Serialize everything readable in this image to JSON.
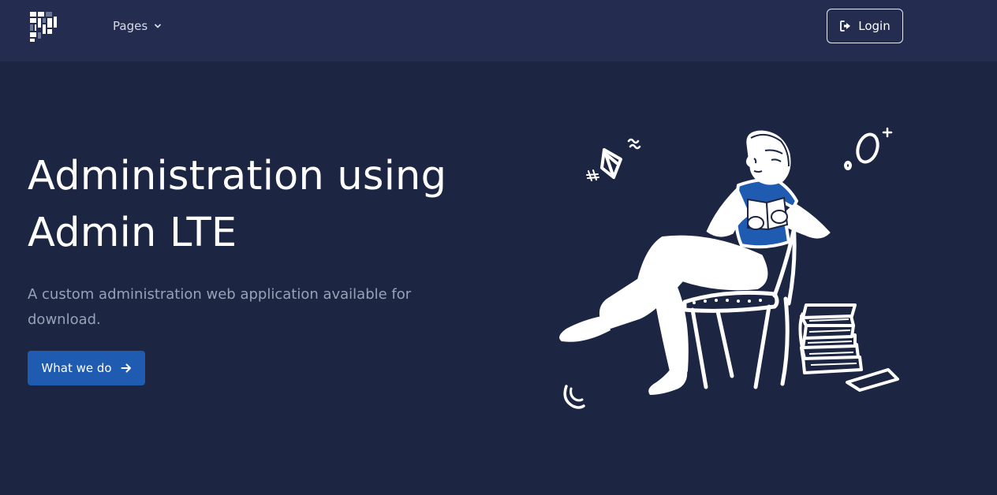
{
  "navbar": {
    "pages_label": "Pages",
    "login_label": "Login"
  },
  "hero": {
    "title_line1": "Administration using",
    "title_line2": "Admin LTE",
    "subtitle": "A custom administration web application available for download.",
    "cta_label": "What we do"
  },
  "icons": {
    "logo": "brand-logo",
    "pages_caret": "chevron-down-icon",
    "login": "sign-in-icon",
    "cta": "arrow-right-icon"
  },
  "colors": {
    "page_bg": "#1c2541",
    "navbar_bg": "#242d4f",
    "accent": "#1f5bb0",
    "illustration_blue": "#1f5bb0"
  }
}
